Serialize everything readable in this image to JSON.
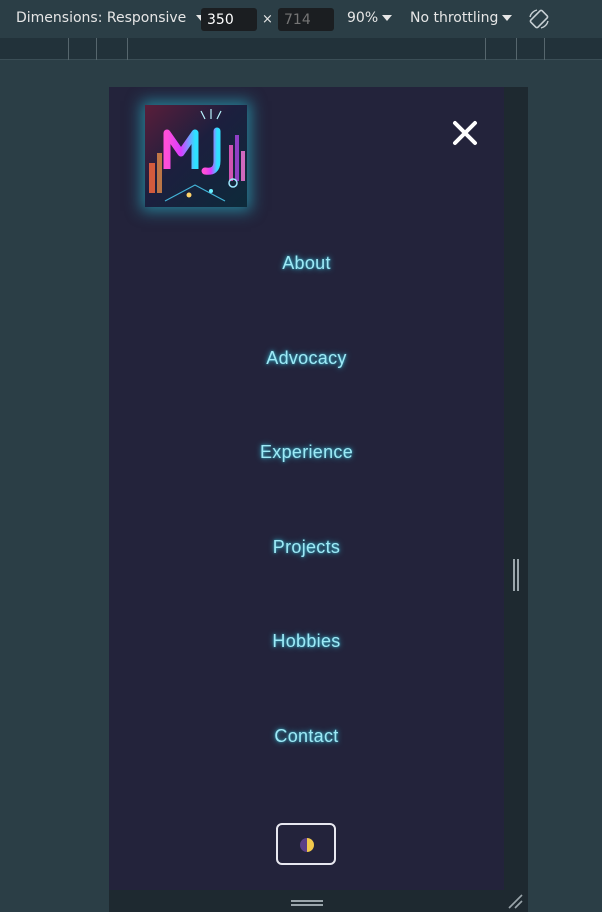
{
  "devtools": {
    "dimensions_label": "Dimensions: Responsive",
    "width_value": "350",
    "height_placeholder": "714",
    "times_symbol": "×",
    "zoom_label": "90%",
    "throttling_label": "No throttling",
    "rotate_icon": "rotate-icon"
  },
  "page": {
    "logo_alt": "MJ",
    "close_icon": "close-icon",
    "nav_items": [
      {
        "label": "About"
      },
      {
        "label": "Advocacy"
      },
      {
        "label": "Experience"
      },
      {
        "label": "Projects"
      },
      {
        "label": "Hobbies"
      },
      {
        "label": "Contact"
      }
    ],
    "theme_toggle_icon": "half-moon-icon"
  },
  "colors": {
    "page_background": "#23233b",
    "nav_text": "#9ee9f6",
    "glow": "#3cd2eb",
    "devtools_background": "#2b3e46"
  }
}
